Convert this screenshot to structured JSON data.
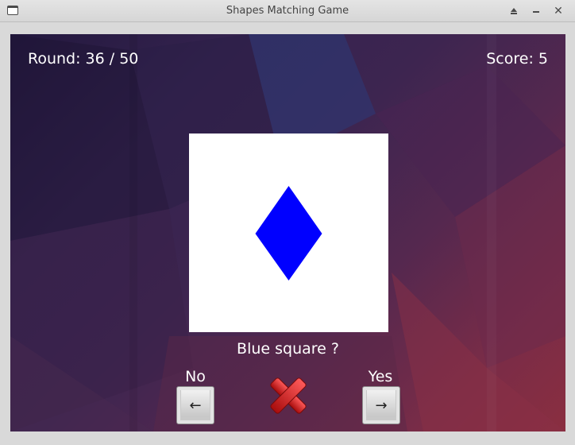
{
  "window": {
    "title": "Shapes Matching Game",
    "icon": "app-window-icon",
    "controls": [
      "shade-icon",
      "minimize-icon",
      "close-icon"
    ]
  },
  "hud": {
    "round": "Round: 36 / 50",
    "score": "Score: 5"
  },
  "card": {
    "shape": "diamond",
    "shape_color": "#0000ff",
    "background": "#ffffff"
  },
  "question": "Blue square ?",
  "answers": {
    "no_label": "No",
    "yes_label": "Yes",
    "no_key": "←",
    "yes_key": "→"
  },
  "feedback": {
    "icon": "red-x-icon",
    "color": "#d11a1a"
  }
}
